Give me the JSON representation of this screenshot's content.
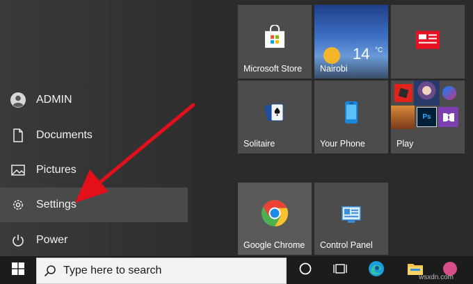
{
  "left_menu": {
    "user": "ADMIN",
    "documents": "Documents",
    "pictures": "Pictures",
    "settings": "Settings",
    "power": "Power"
  },
  "tiles": {
    "store": "Microsoft Store",
    "weather_temp": "14",
    "weather_unit": "°C",
    "weather_city": "Nairobi",
    "solitaire": "Solitaire",
    "phone": "Your Phone",
    "play": "Play",
    "chrome": "Google Chrome",
    "control_panel": "Control Panel"
  },
  "taskbar": {
    "search_placeholder": "Type here to search"
  },
  "watermark": "wsxdn.com",
  "colors": {
    "arrow": "#e3101b",
    "tile": "#4c4c4c",
    "taskbar": "#1c1c1c"
  }
}
